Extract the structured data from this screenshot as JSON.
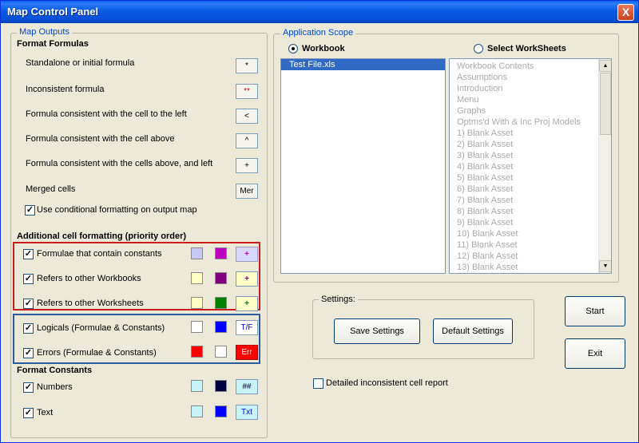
{
  "window": {
    "title": "Map Control Panel",
    "close_glyph": "X"
  },
  "map_outputs": {
    "legend": "Map Outputs",
    "format_formulas": {
      "heading": "Format Formulas",
      "rows": [
        {
          "label": "Standalone or initial formula",
          "sample": "*",
          "sample_color": "#000000"
        },
        {
          "label": "Inconsistent formula",
          "sample": "**",
          "sample_color": "#e00000"
        },
        {
          "label": "Formula consistent with the cell to the left",
          "sample": "<",
          "sample_color": "#000000"
        },
        {
          "label": "Formula consistent with the cell above",
          "sample": "^",
          "sample_color": "#000000"
        },
        {
          "label": "Formula consistent with the cells above, and  left",
          "sample": "+",
          "sample_color": "#000000"
        },
        {
          "label": "Merged cells",
          "sample": "Mer",
          "sample_color": "#000000"
        }
      ],
      "conditional_formatting_label": "Use conditional formatting on output map",
      "conditional_formatting_checked": true
    },
    "additional": {
      "heading": "Additional cell formatting (priority order)",
      "rows": [
        {
          "label": "Formulae that contain constants",
          "checked": true,
          "color1": "#c8c8f4",
          "color2": "#c000c0",
          "sample": "+",
          "sample_bg": "#d8d8ff",
          "sample_fg": "#c000c0"
        },
        {
          "label": "Refers to other Workbooks",
          "checked": true,
          "color1": "#ffffc8",
          "color2": "#800080",
          "sample": "+",
          "sample_bg": "#ffffc8",
          "sample_fg": "#800080"
        },
        {
          "label": "Refers to other Worksheets",
          "checked": true,
          "color1": "#ffffc8",
          "color2": "#008000",
          "sample": "+",
          "sample_bg": "#ffffc8",
          "sample_fg": "#008000"
        },
        {
          "label": "Logicals (Formulae & Constants)",
          "checked": true,
          "color1": "#ffffff",
          "color2": "#0000ff",
          "sample": "T/F",
          "sample_bg": "#ffffff",
          "sample_fg": "#0000ff"
        },
        {
          "label": "Errors (Formulae & Constants)",
          "checked": true,
          "color1": "#ff0000",
          "color2": "#ffffff",
          "sample": "Err",
          "sample_bg": "#ff0000",
          "sample_fg": "#ffffff"
        }
      ]
    },
    "format_constants": {
      "heading": "Format Constants",
      "rows": [
        {
          "label": "Numbers",
          "checked": true,
          "color1": "#c8f4f8",
          "color2": "#000040",
          "sample": "##",
          "sample_bg": "#c8f4f8",
          "sample_fg": "#000040"
        },
        {
          "label": "Text",
          "checked": true,
          "color1": "#c8f4f8",
          "color2": "#0000ff",
          "sample": "Txt",
          "sample_bg": "#c8f4f8",
          "sample_fg": "#0000ff"
        }
      ]
    }
  },
  "application_scope": {
    "legend": "Application Scope",
    "workbook_label": "Workbook",
    "worksheets_label": "Select WorkSheets",
    "selected": "workbook",
    "workbooks": [
      "Test File.xls"
    ],
    "worksheets": [
      "Workbook Contents",
      "Assumptions",
      "Introduction",
      "Menu",
      "Graphs",
      "Optms'd With & Inc Proj Models",
      "1) Blank Asset",
      "2) Blank Asset",
      "3) Blank Asset",
      "4) Blank Asset",
      "5) Blank Asset",
      "6) Blank Asset",
      "7) Blank Asset",
      "8) Blank Asset",
      "9) Blank Asset",
      "10) Blank Asset",
      "11) Blank Asset",
      "12) Blank Asset",
      "13) Blank Asset"
    ]
  },
  "settings": {
    "legend": "Settings:",
    "save_label": "Save Settings",
    "default_label": "Default  Settings"
  },
  "buttons": {
    "start_label": "Start",
    "exit_label": "Exit"
  },
  "report": {
    "label": "Detailed inconsistent cell report",
    "checked": false
  },
  "icons": {
    "scroll_up": "▲",
    "scroll_down": "▼"
  }
}
